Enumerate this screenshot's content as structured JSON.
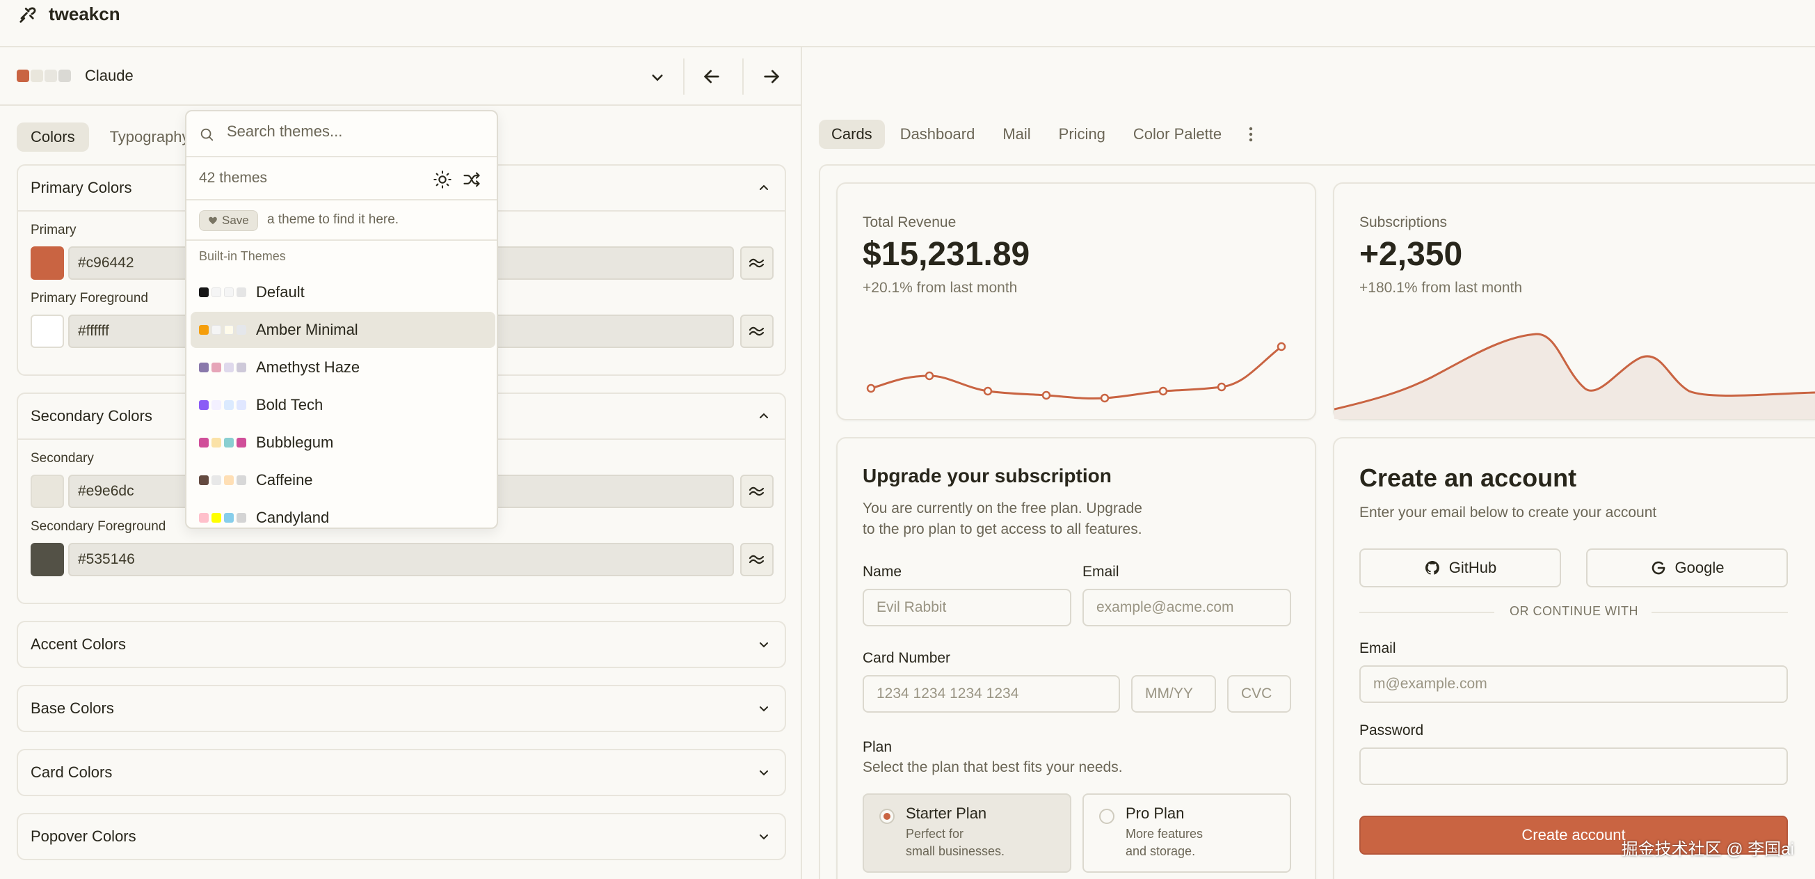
{
  "app": {
    "name": "tweakcn"
  },
  "theme_bar": {
    "current_theme": "Claude",
    "swatch_colors": [
      "#c96442",
      "#e9e6dc",
      "#e8e6df",
      "#dad9d4"
    ]
  },
  "editor_tabs": [
    "Colors",
    "Typography"
  ],
  "sections": {
    "primary": {
      "title": "Primary Colors",
      "fields": [
        {
          "label": "Primary",
          "value": "#c96442",
          "color": "#c96442"
        },
        {
          "label": "Primary Foreground",
          "value": "#ffffff",
          "color": "#ffffff"
        }
      ]
    },
    "secondary": {
      "title": "Secondary Colors",
      "fields": [
        {
          "label": "Secondary",
          "value": "#e9e6dc",
          "color": "#e9e6dc"
        },
        {
          "label": "Secondary Foreground",
          "value": "#535146",
          "color": "#535146"
        }
      ]
    },
    "collapsed": [
      "Accent Colors",
      "Base Colors",
      "Card Colors",
      "Popover Colors"
    ]
  },
  "dropdown": {
    "search_placeholder": "Search themes...",
    "count": "42 themes",
    "save_label": "Save",
    "hint": "a theme to find it here.",
    "group": "Built-in Themes",
    "themes": [
      {
        "name": "Default",
        "colors": [
          "#171717",
          "#f5f5f5",
          "#f5f5f5",
          "#e5e5e5"
        ]
      },
      {
        "name": "Amber Minimal",
        "colors": [
          "#f59e0b",
          "#f5f5f5",
          "#fffbeb",
          "#e5e7eb"
        ]
      },
      {
        "name": "Amethyst Haze",
        "colors": [
          "#8a79ab",
          "#e6a5b8",
          "#dfd9ec",
          "#cec9d9"
        ]
      },
      {
        "name": "Bold Tech",
        "colors": [
          "#8b5cf6",
          "#f3f0ff",
          "#dbeafe",
          "#e0e7ff"
        ]
      },
      {
        "name": "Bubblegum",
        "colors": [
          "#d04f99",
          "#8acfd1",
          "#fbe2a7",
          "#d04f99"
        ]
      },
      {
        "name": "Caffeine",
        "colors": [
          "#644a40",
          "#ffdfb5",
          "#e8e8e8",
          "#d8d8d8"
        ]
      },
      {
        "name": "Candyland",
        "colors": [
          "#ffc0cb",
          "#ffff00",
          "#87ceeb",
          "#d4d4d4"
        ]
      }
    ]
  },
  "preview_tabs": [
    "Cards",
    "Dashboard",
    "Mail",
    "Pricing",
    "Color Palette"
  ],
  "revenue": {
    "label": "Total Revenue",
    "value": "$15,231.89",
    "sub": "+20.1% from last month"
  },
  "subscriptions": {
    "label": "Subscriptions",
    "value": "+2,350",
    "sub": "+180.1% from last month"
  },
  "upgrade": {
    "title": "Upgrade your subscription",
    "desc_line1": "You are currently on the free plan. Upgrade",
    "desc_line2": "to the pro plan to get access to all features.",
    "name_label": "Name",
    "name_placeholder": "Evil Rabbit",
    "email_label": "Email",
    "email_placeholder": "example@acme.com",
    "card_label": "Card Number",
    "card_placeholder": "1234 1234 1234 1234",
    "mmyy_placeholder": "MM/YY",
    "cvc_placeholder": "CVC",
    "plan_label": "Plan",
    "plan_desc": "Select the plan that best fits your needs.",
    "plans": [
      {
        "title": "Starter Plan",
        "desc1": "Perfect for",
        "desc2": "small businesses."
      },
      {
        "title": "Pro Plan",
        "desc1": "More features",
        "desc2": "and storage."
      }
    ]
  },
  "account": {
    "title": "Create an account",
    "desc": "Enter your email below to create your account",
    "github": "GitHub",
    "google": "Google",
    "divider": "OR CONTINUE WITH",
    "email_label": "Email",
    "email_placeholder": "m@example.com",
    "password_label": "Password",
    "cta": "Create account"
  },
  "watermark": "掘金技术社区 @ 李国ai"
}
